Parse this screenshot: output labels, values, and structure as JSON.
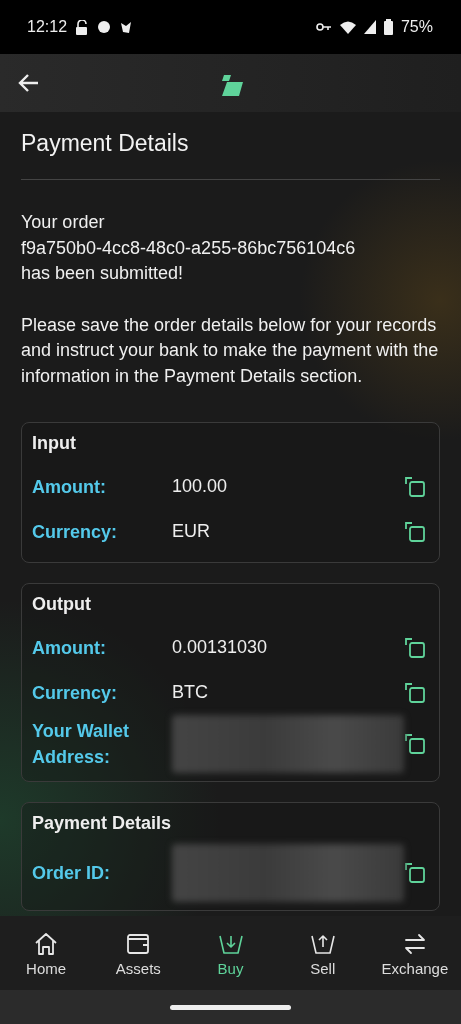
{
  "status_bar": {
    "time": "12:12",
    "battery": "75%"
  },
  "header": {
    "title": "Payment Details"
  },
  "message": {
    "intro": "Your order",
    "order_id": "f9a750b0-4cc8-48c0-a255-86bc756104c6",
    "submitted": "has been submitted!",
    "instructions": "Please save the order details below for your records and instruct your bank to make the payment with the information in the Payment Details section."
  },
  "sections": [
    {
      "title": "Input",
      "rows": [
        {
          "label": "Amount:",
          "value": "100.00"
        },
        {
          "label": "Currency:",
          "value": "EUR"
        }
      ]
    },
    {
      "title": "Output",
      "rows": [
        {
          "label": "Amount:",
          "value": "0.00131030"
        },
        {
          "label": "Currency:",
          "value": "BTC"
        },
        {
          "label": "Your Wallet Address:",
          "kind": "blurred"
        }
      ]
    },
    {
      "title": "Payment Details",
      "rows": [
        {
          "label": "Order ID:",
          "kind": "blurred"
        }
      ]
    }
  ],
  "nav": [
    {
      "label": "Home",
      "selected": false
    },
    {
      "label": "Assets",
      "selected": false
    },
    {
      "label": "Buy",
      "selected": true
    },
    {
      "label": "Sell",
      "selected": false
    },
    {
      "label": "Exchange",
      "selected": false
    }
  ]
}
